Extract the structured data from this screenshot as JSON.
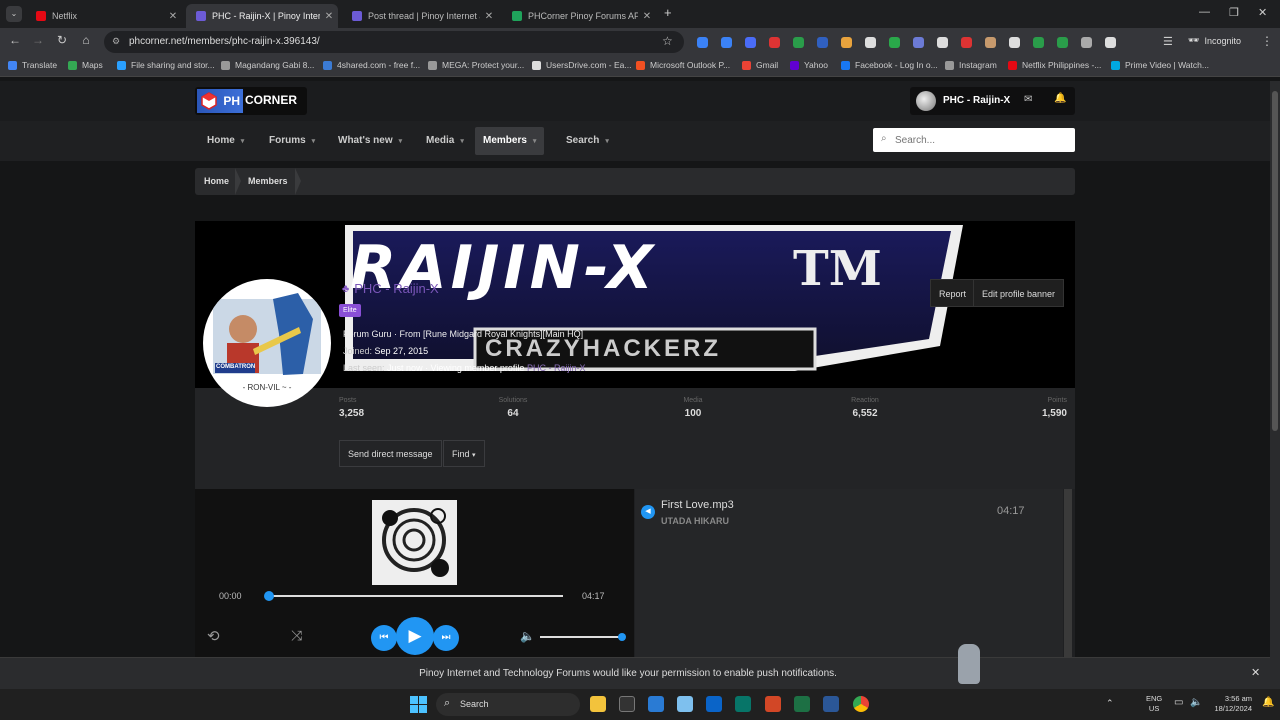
{
  "browser": {
    "tabs": [
      {
        "title": "Netflix",
        "active": false,
        "color": "#e50914"
      },
      {
        "title": "PHC - Raijin-X | Pinoy Internet a",
        "active": true,
        "color": "#6c5bd6"
      },
      {
        "title": "Post thread | Pinoy Internet an",
        "active": false,
        "color": "#6c5bd6"
      },
      {
        "title": "PHCorner Pinoy Forums APK (A",
        "active": false,
        "color": "#1fa35b"
      }
    ],
    "new_tab": "+",
    "url": "phcorner.net/members/phc-raijin-x.396143/",
    "incognito_label": "Incognito",
    "bookmarks": [
      {
        "label": "Translate",
        "icon": "translate-icon",
        "color": "#4285f4"
      },
      {
        "label": "Maps",
        "icon": "maps-icon",
        "color": "#34a853"
      },
      {
        "label": "File sharing and stor...",
        "icon": "cloud-icon",
        "color": "#2aa0ff"
      },
      {
        "label": "Magandang Gabi 8...",
        "icon": "globe-icon",
        "color": "#999"
      },
      {
        "label": "4shared.com - free f...",
        "icon": "4shared-icon",
        "color": "#3b7bd4"
      },
      {
        "label": "MEGA: Protect your...",
        "icon": "globe-icon",
        "color": "#999"
      },
      {
        "label": "UsersDrive.com - Ea...",
        "icon": "usersdrive-icon",
        "color": "#ddd"
      },
      {
        "label": "Microsoft Outlook P...",
        "icon": "microsoft-icon",
        "color": "#f25022"
      },
      {
        "label": "Gmail",
        "icon": "gmail-icon",
        "color": "#ea4335"
      },
      {
        "label": "Yahoo",
        "icon": "yahoo-icon",
        "color": "#6001d2"
      },
      {
        "label": "Facebook - Log In o...",
        "icon": "facebook-icon",
        "color": "#1877f2"
      },
      {
        "label": "Instagram",
        "icon": "globe-icon",
        "color": "#999"
      },
      {
        "label": "Netflix Philippines -...",
        "icon": "netflix-icon",
        "color": "#e50914"
      },
      {
        "label": "Prime Video | Watch...",
        "icon": "prime-video-icon",
        "color": "#00a8e1"
      }
    ]
  },
  "site": {
    "logo_ph": "PH",
    "logo_corner": "CORNER",
    "username": "PHC - Raijin-X",
    "nav": [
      {
        "label": "Home",
        "active": false
      },
      {
        "label": "Forums",
        "active": false
      },
      {
        "label": "What's new",
        "active": false
      },
      {
        "label": "Media",
        "active": false
      },
      {
        "label": "Members",
        "active": true
      },
      {
        "label": "Search",
        "active": false
      }
    ],
    "search_placeholder": "Search...",
    "breadcrumbs": [
      "Home",
      "Members"
    ]
  },
  "profile": {
    "banner_text": "RAIJIN-X",
    "banner_tm": "TM",
    "banner_sub": "CRAZYHACKERZ",
    "avatar_caption": "- RON-VIL ~ -",
    "avatar_tag": "COMBATRON",
    "name": "PHC - Raijin-X",
    "badge": "Elite",
    "title_line": "Forum Guru · From [Rune Midgard Royal Knights][Main HQ]",
    "joined_label": "Joined:",
    "joined_value": "Sep 27, 2015",
    "last_seen_label": "Last seen:",
    "last_seen_value": "Just now · Viewing member profile",
    "last_seen_name": "PHC - Raijin-X",
    "report_label": "Report",
    "edit_banner_label": "Edit profile banner",
    "stats": [
      {
        "label": "Posts",
        "value": "3,258"
      },
      {
        "label": "Solutions",
        "value": "64"
      },
      {
        "label": "Media",
        "value": "100"
      },
      {
        "label": "Reaction",
        "value": "6,552"
      },
      {
        "label": "Points",
        "value": "1,590"
      }
    ],
    "send_dm_label": "Send direct message",
    "find_label": "Find"
  },
  "player": {
    "current_time": "00:00",
    "total_time": "04:17",
    "progress": 0,
    "volume": 1.0,
    "track_title": "First Love.mp3",
    "track_artist": "UTADA HIKARU",
    "track_duration": "04:17"
  },
  "notification": {
    "text": "Pinoy Internet and Technology Forums would like your permission to enable push notifications."
  },
  "taskbar": {
    "search_label": "Search",
    "lang": "ENG",
    "region": "US",
    "time": "3:56 am",
    "date": "18/12/2024"
  }
}
